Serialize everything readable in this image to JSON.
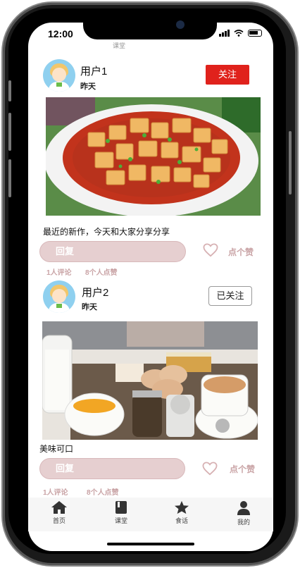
{
  "status_bar": {
    "time": "12:00"
  },
  "screen_title": "课堂",
  "posts": [
    {
      "username": "用户1",
      "time": "昨天",
      "follow_label": "关注",
      "caption": "最近的新作，今天和大家分享分享",
      "reply_label": "回复",
      "like_label": "点个赞",
      "comments": "1人评论",
      "likes": "8个人点赞"
    },
    {
      "username": "用户2",
      "time": "昨天",
      "follow_label": "已关注",
      "caption": "美味可口",
      "reply_label": "回复",
      "like_label": "点个赞",
      "comments": "1人评论",
      "likes": "8个人点赞"
    }
  ],
  "tabbar": {
    "items": [
      {
        "label": "首页",
        "icon": "home-icon"
      },
      {
        "label": "课堂",
        "icon": "book-icon"
      },
      {
        "label": "食话",
        "icon": "star-icon"
      },
      {
        "label": "我的",
        "icon": "person-icon"
      }
    ]
  },
  "colors": {
    "follow_button": "#e0221c",
    "reply_pill": "#e6cfd0",
    "accent_text": "#c9a3a5"
  }
}
